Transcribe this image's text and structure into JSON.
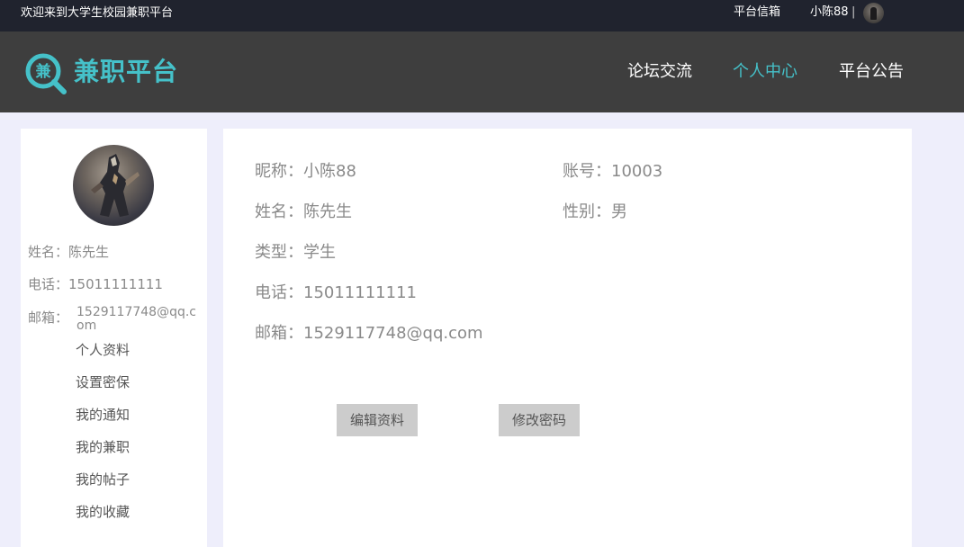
{
  "topbar": {
    "welcome": "欢迎来到大学生校园兼职平台",
    "inbox": "平台信箱",
    "username": "小陈88",
    "separator": "|"
  },
  "header": {
    "logo_glyph": "兼",
    "logo_text": "兼职平台",
    "nav": [
      {
        "label": "论坛交流",
        "active": false
      },
      {
        "label": "个人中心",
        "active": true
      },
      {
        "label": "平台公告",
        "active": false
      }
    ],
    "accent_color": "#45c1c9"
  },
  "sidebar": {
    "name": "姓名：陈先生",
    "phone": "电话：15011111111",
    "email_label": "邮箱：",
    "email_value": "1529117748@qq.com",
    "menu": [
      "个人资料",
      "设置密保",
      "我的通知",
      "我的兼职",
      "我的帖子",
      "我的收藏"
    ]
  },
  "profile": {
    "nickname": "昵称：小陈88",
    "account": "账号：10003",
    "name": "姓名：陈先生",
    "gender": "性别：男",
    "type": "类型：学生",
    "phone": "电话：15011111111",
    "email": "邮箱：1529117748@qq.com",
    "edit_button": "编辑资料",
    "password_button": "修改密码"
  }
}
